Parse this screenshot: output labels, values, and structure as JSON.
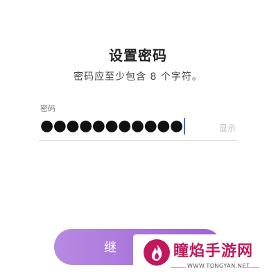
{
  "header": {
    "title": "设置密码",
    "subtitle": "密码应至少包含 8 个字符。"
  },
  "password": {
    "label": "密码",
    "masked_value": "●●●●●●●●●●●",
    "show_label": "显示"
  },
  "actions": {
    "continue_label": "继"
  },
  "watermark": {
    "logo": "flame-logo",
    "title": "瞳焰手游网",
    "url": "WWW.TONGYAN.NET"
  },
  "colors": {
    "button_start": "#b78ae0",
    "button_end": "#9b63d6",
    "caret": "#2f6fe0",
    "watermark_title": "#c2185b"
  }
}
